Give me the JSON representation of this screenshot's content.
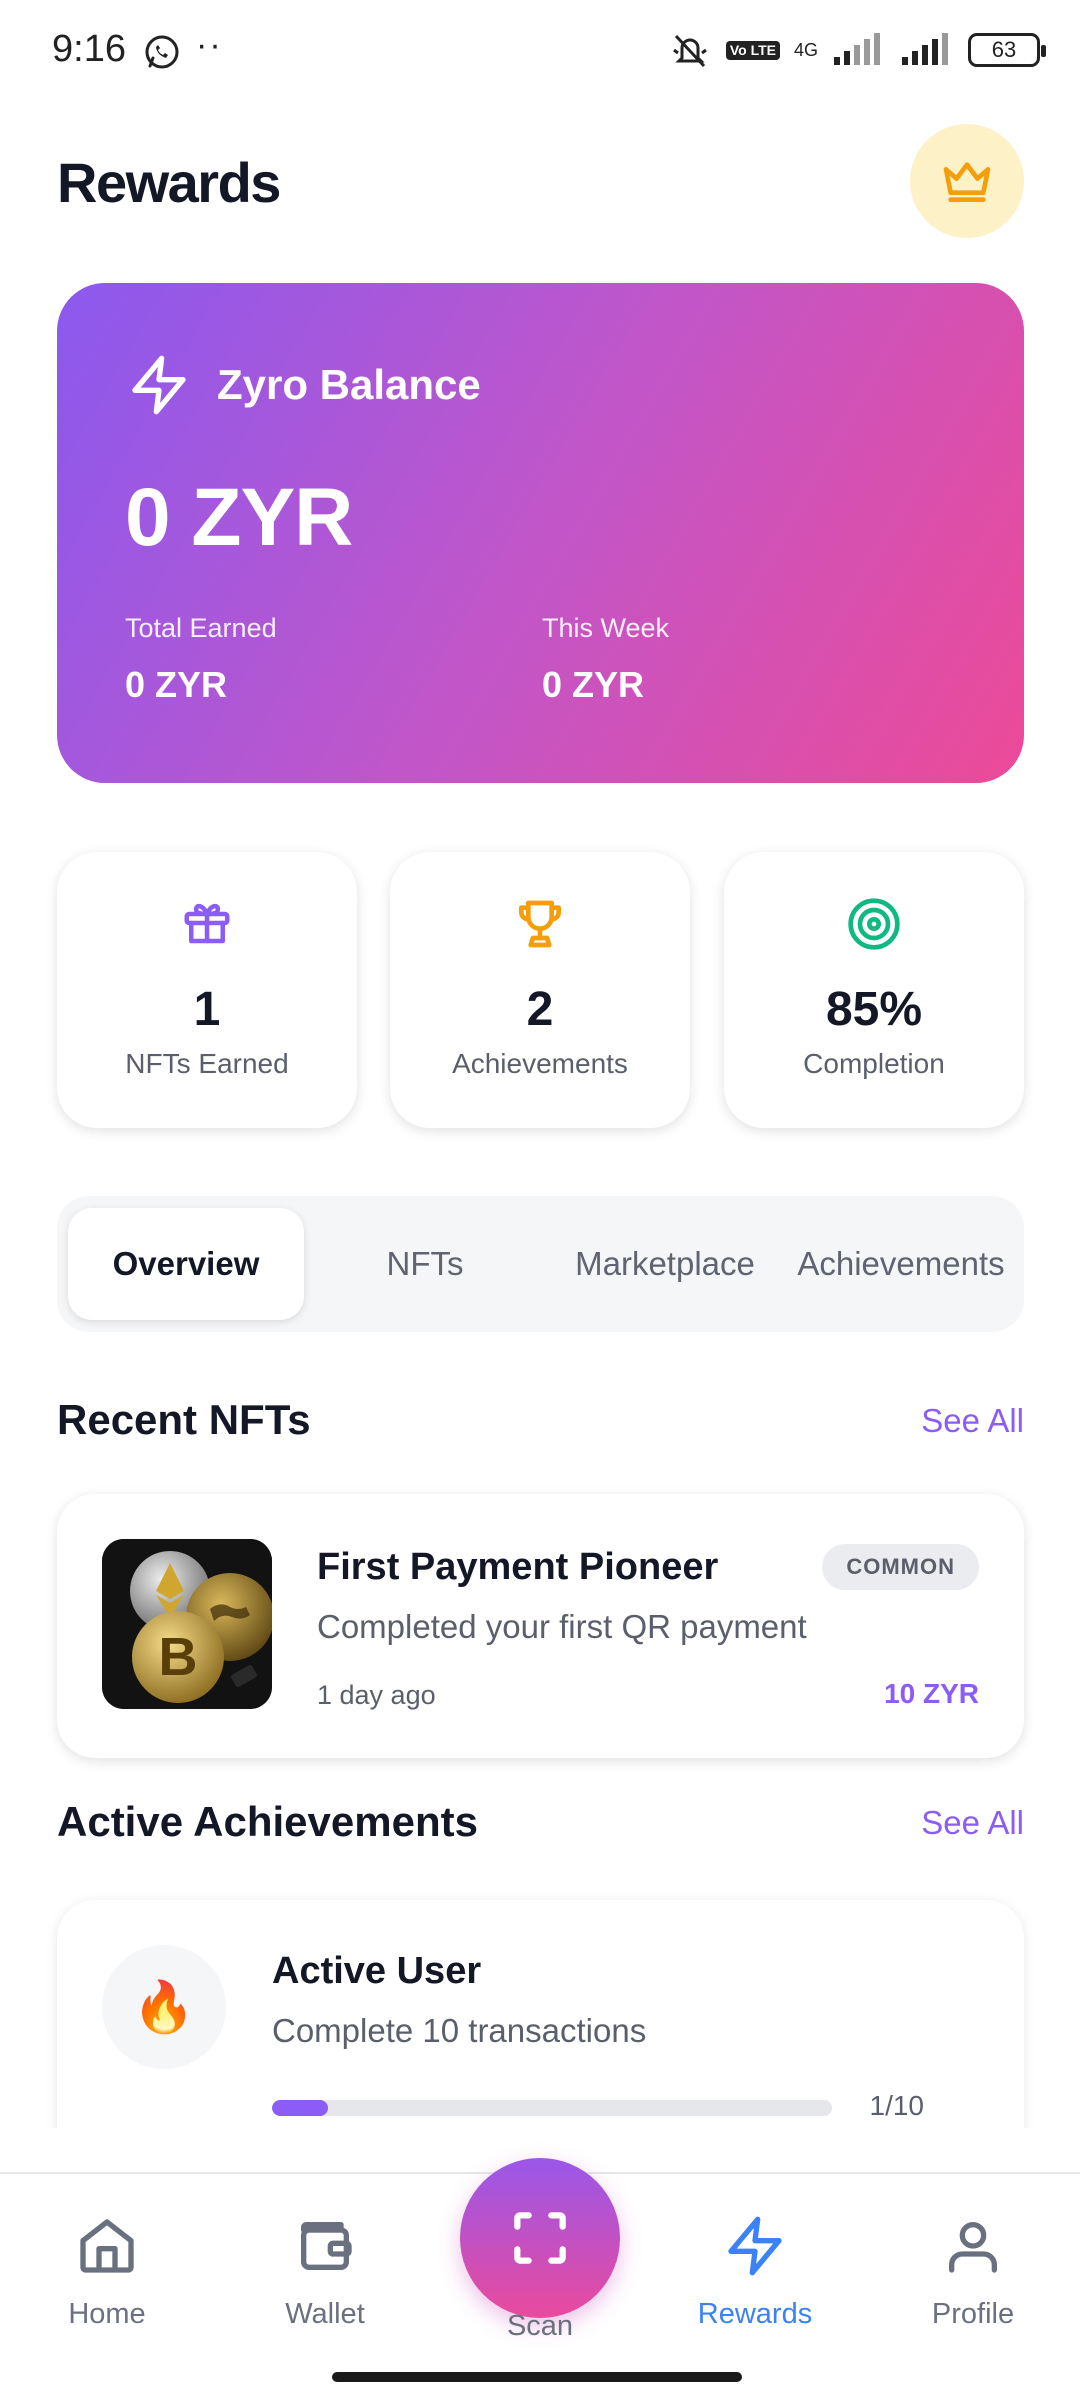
{
  "status_bar": {
    "time": "9:16",
    "dots": "··",
    "network_badge": "Vo LTE",
    "network_type": "4G",
    "battery": "63"
  },
  "header": {
    "title": "Rewards",
    "crown_icon": "crown-icon"
  },
  "balance": {
    "title": "Zyro Balance",
    "amount": "0 ZYR",
    "total_earned_label": "Total Earned",
    "total_earned_value": "0 ZYR",
    "this_week_label": "This Week",
    "this_week_value": "0 ZYR",
    "gradient": [
      "#8b59ee",
      "#ec4a97"
    ]
  },
  "stats": [
    {
      "icon": "gift-icon",
      "value": "1",
      "label": "NFTs Earned",
      "color": "#8b5cf6"
    },
    {
      "icon": "trophy-icon",
      "value": "2",
      "label": "Achievements",
      "color": "#f59e0b"
    },
    {
      "icon": "target-icon",
      "value": "85%",
      "label": "Completion",
      "color": "#10b981"
    }
  ],
  "tabs": [
    {
      "label": "Overview",
      "active": true
    },
    {
      "label": "NFTs",
      "active": false
    },
    {
      "label": "Marketplace",
      "active": false
    },
    {
      "label": "Achievements",
      "active": false
    }
  ],
  "recent_nfts": {
    "title": "Recent NFTs",
    "see_all": "See All",
    "items": [
      {
        "name": "First Payment Pioneer",
        "rarity": "COMMON",
        "description": "Completed your first QR payment",
        "time": "1 day ago",
        "reward": "10 ZYR"
      }
    ]
  },
  "active_achievements": {
    "title": "Active Achievements",
    "see_all": "See All",
    "items": [
      {
        "icon": "fire-icon",
        "emoji": "🔥",
        "title": "Active User",
        "description": "Complete 10 transactions",
        "progress": 0.1,
        "count": "1/10"
      }
    ]
  },
  "bottom_nav": {
    "items": [
      {
        "label": "Home",
        "icon": "home-icon",
        "active": false
      },
      {
        "label": "Wallet",
        "icon": "wallet-icon",
        "active": false
      },
      {
        "label": "Scan",
        "icon": "scan-icon",
        "active": false
      },
      {
        "label": "Rewards",
        "icon": "lightning-icon",
        "active": true
      },
      {
        "label": "Profile",
        "icon": "user-icon",
        "active": false
      }
    ],
    "accent": "#3b82f6"
  }
}
